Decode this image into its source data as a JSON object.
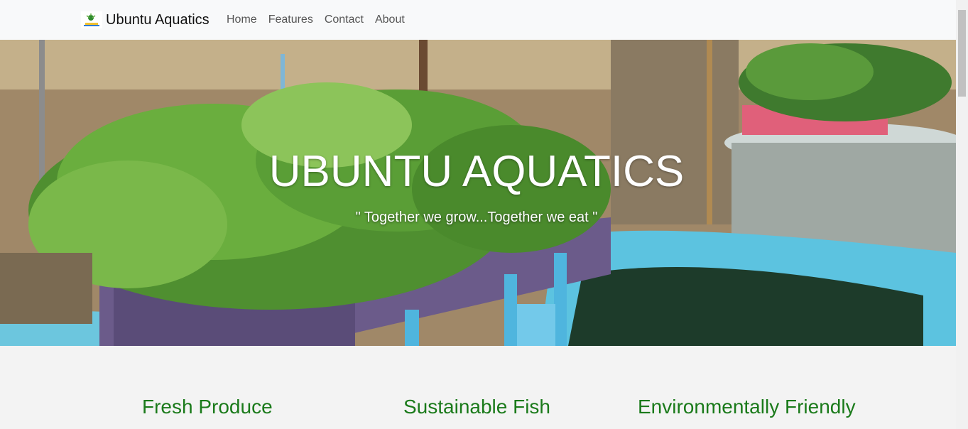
{
  "navbar": {
    "brand_name": "Ubuntu Aquatics",
    "links": [
      "Home",
      "Features",
      "Contact",
      "About"
    ]
  },
  "hero": {
    "title": "UBUNTU AQUATICS",
    "tagline": "\" Together we grow...Together we eat \""
  },
  "features": [
    {
      "title": "Fresh Produce"
    },
    {
      "title": "Sustainable Fish"
    },
    {
      "title": "Environmentally Friendly"
    }
  ],
  "colors": {
    "navbar_bg": "#f8f9fa",
    "feature_title": "#1a7a1a",
    "page_bg": "#f3f3f3"
  }
}
